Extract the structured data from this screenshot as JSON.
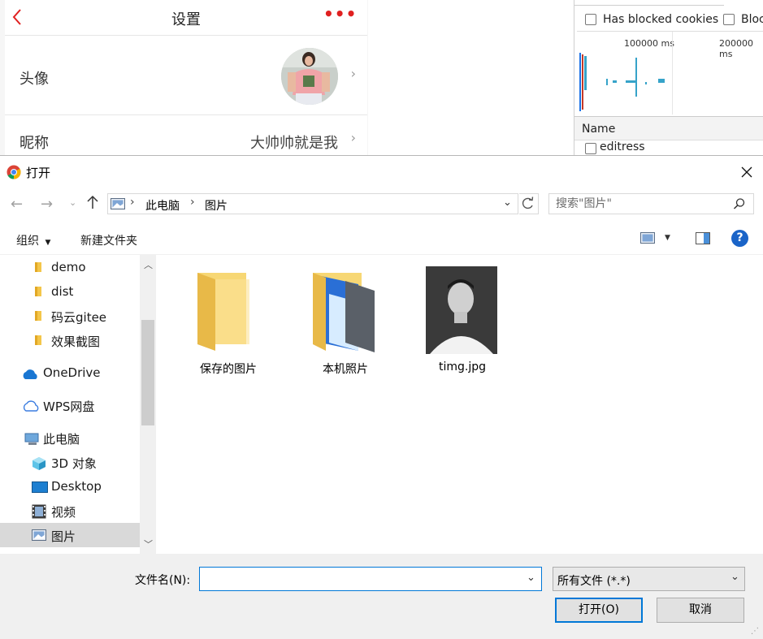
{
  "mobile": {
    "title": "设置",
    "more": "•••",
    "rows": [
      {
        "label": "头像"
      },
      {
        "label": "昵称",
        "value": "大帅帅就是我"
      }
    ]
  },
  "devtools": {
    "has_blocked_cookies": "Has blocked cookies",
    "blocked_truncated": "Bloc",
    "ticks": [
      "100000 ms",
      "200000 ms"
    ],
    "name_header": "Name",
    "first_request": "editress"
  },
  "dialog": {
    "title": "打开",
    "breadcrumb": [
      "此电脑",
      "图片"
    ],
    "search_placeholder": "搜索\"图片\"",
    "commands": {
      "organize": "组织",
      "new_folder": "新建文件夹",
      "help": "?"
    },
    "nav_items": [
      {
        "label": "demo",
        "icon": "folder-icon"
      },
      {
        "label": "dist",
        "icon": "folder-icon"
      },
      {
        "label": "码云gitee",
        "icon": "folder-icon"
      },
      {
        "label": "效果截图",
        "icon": "folder-icon"
      },
      {
        "label": "OneDrive",
        "icon": "onedrive-icon"
      },
      {
        "label": "WPS网盘",
        "icon": "cloud-icon"
      },
      {
        "label": "此电脑",
        "icon": "computer-icon"
      },
      {
        "label": "3D 对象",
        "icon": "cube-icon"
      },
      {
        "label": "Desktop",
        "icon": "desktop-icon"
      },
      {
        "label": "视频",
        "icon": "video-icon"
      },
      {
        "label": "图片",
        "icon": "pictures-icon"
      }
    ],
    "files": [
      {
        "name": "保存的图片",
        "kind": "folder"
      },
      {
        "name": "本机照片",
        "kind": "folder-with-photos"
      },
      {
        "name": "timg.jpg",
        "kind": "image"
      }
    ],
    "filename_label": "文件名(N):",
    "filename_value": "",
    "filetype": "所有文件 (*.*)",
    "open_label": "打开(O)",
    "cancel_label": "取消"
  },
  "colors": {
    "accent": "#0078d7",
    "mobile_red": "#e02020",
    "selected_nav": "#d9d9d9"
  }
}
